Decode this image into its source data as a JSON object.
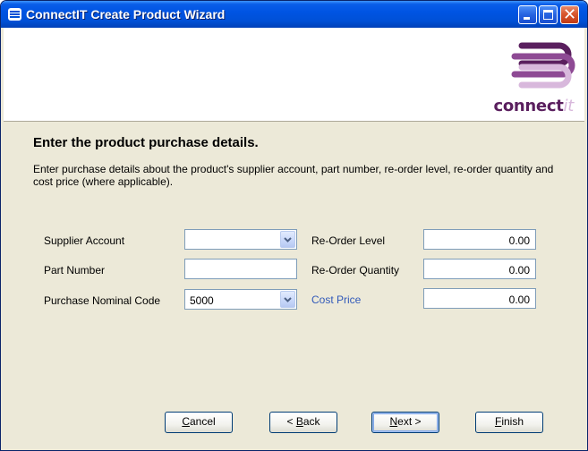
{
  "window": {
    "title": "ConnectIT Create Product Wizard",
    "controls": [
      "minimize-icon",
      "maximize-icon",
      "close-icon"
    ]
  },
  "brand": {
    "logo_text_main": "connect",
    "logo_text_suffix": "it",
    "colors": {
      "logo_dark": "#5a1f5e",
      "logo_mid": "#8e4a94",
      "logo_light": "#d8b8dc"
    }
  },
  "page": {
    "heading": "Enter the product purchase details.",
    "description": "Enter purchase details about the product's supplier account, part number, re-order level, re-order quantity and cost price (where applicable)."
  },
  "form": {
    "supplier_account": {
      "label": "Supplier Account",
      "value": ""
    },
    "part_number": {
      "label": "Part Number",
      "value": ""
    },
    "purchase_nominal_code": {
      "label": "Purchase Nominal Code",
      "value": "5000"
    },
    "reorder_level": {
      "label": "Re-Order Level",
      "value": "0.00"
    },
    "reorder_quantity": {
      "label": "Re-Order Quantity",
      "value": "0.00"
    },
    "cost_price": {
      "label": "Cost Price",
      "value": "0.00",
      "label_color": "#3159b9"
    }
  },
  "buttons": {
    "cancel": {
      "label_accel": "C",
      "label_rest": "ancel"
    },
    "back": {
      "label_prefix": "< ",
      "label_accel": "B",
      "label_rest": "ack"
    },
    "next": {
      "label_accel": "N",
      "label_rest": "ext >"
    },
    "finish": {
      "label_accel": "F",
      "label_rest": "inish"
    }
  }
}
